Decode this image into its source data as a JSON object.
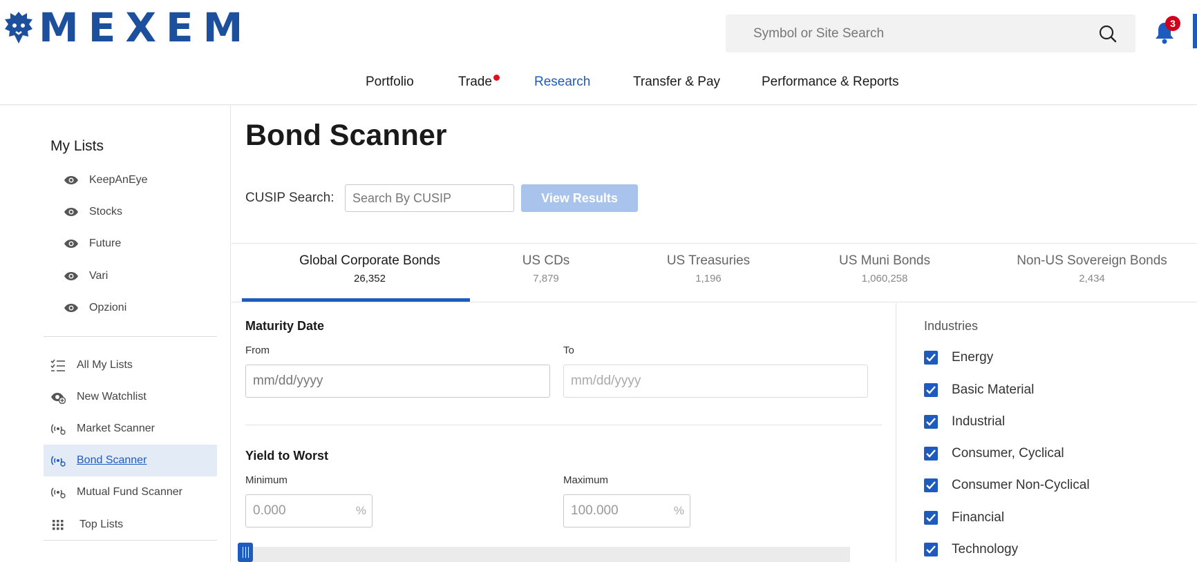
{
  "brand": {
    "name": "MEXEM",
    "color": "#1c4f9c"
  },
  "header": {
    "search_placeholder": "Symbol or Site Search",
    "notification_count": "3"
  },
  "nav": {
    "items": [
      {
        "label": "Portfolio",
        "active": false
      },
      {
        "label": "Trade",
        "active": false,
        "has_dot": true
      },
      {
        "label": "Research",
        "active": true
      },
      {
        "label": "Transfer & Pay",
        "active": false
      },
      {
        "label": "Performance & Reports",
        "active": false
      }
    ]
  },
  "sidebar": {
    "title": "My Lists",
    "lists": [
      {
        "label": "KeepAnEye",
        "icon": "eye-icon"
      },
      {
        "label": "Stocks",
        "icon": "eye-icon"
      },
      {
        "label": "Future",
        "icon": "eye-icon"
      },
      {
        "label": "Vari",
        "icon": "eye-icon"
      },
      {
        "label": "Opzioni",
        "icon": "eye-icon"
      }
    ],
    "links": [
      {
        "label": "All My Lists",
        "icon": "checklist-icon",
        "active": false
      },
      {
        "label": "New Watchlist",
        "icon": "eye-plus-icon",
        "active": false
      },
      {
        "label": "Market Scanner",
        "icon": "scanner-icon",
        "active": false
      },
      {
        "label": "Bond Scanner",
        "icon": "scanner-icon",
        "active": true
      },
      {
        "label": "Mutual Fund Scanner",
        "icon": "scanner-icon",
        "active": false
      },
      {
        "label": "Top Lists",
        "icon": "grid-icon",
        "active": false
      }
    ]
  },
  "page": {
    "title": "Bond Scanner",
    "cusip_label": "CUSIP Search:",
    "cusip_placeholder": "Search By CUSIP",
    "view_results_label": "View Results"
  },
  "tabs": [
    {
      "label": "Global Corporate Bonds",
      "count": "26,352",
      "active": true
    },
    {
      "label": "US CDs",
      "count": "7,879",
      "active": false
    },
    {
      "label": "US Treasuries",
      "count": "1,196",
      "active": false
    },
    {
      "label": "US Muni Bonds",
      "count": "1,060,258",
      "active": false
    },
    {
      "label": "Non-US Sovereign Bonds",
      "count": "2,434",
      "active": false
    }
  ],
  "filters": {
    "maturity": {
      "title": "Maturity Date",
      "from_label": "From",
      "to_label": "To",
      "from_placeholder": "mm/dd/yyyy",
      "to_placeholder": "mm/dd/yyyy"
    },
    "yield": {
      "title": "Yield to Worst",
      "min_label": "Minimum",
      "max_label": "Maximum",
      "min_placeholder": "0.000",
      "max_placeholder": "100.000",
      "unit": "%"
    }
  },
  "industries": {
    "title": "Industries",
    "items": [
      {
        "label": "Energy",
        "checked": true
      },
      {
        "label": "Basic Material",
        "checked": true
      },
      {
        "label": "Industrial",
        "checked": true
      },
      {
        "label": "Consumer, Cyclical",
        "checked": true
      },
      {
        "label": "Consumer Non-Cyclical",
        "checked": true
      },
      {
        "label": "Financial",
        "checked": true
      },
      {
        "label": "Technology",
        "checked": true
      }
    ]
  },
  "colors": {
    "accent": "#1d5bbf",
    "badge": "#d0021b",
    "button_disabled": "#a9c4ec"
  }
}
